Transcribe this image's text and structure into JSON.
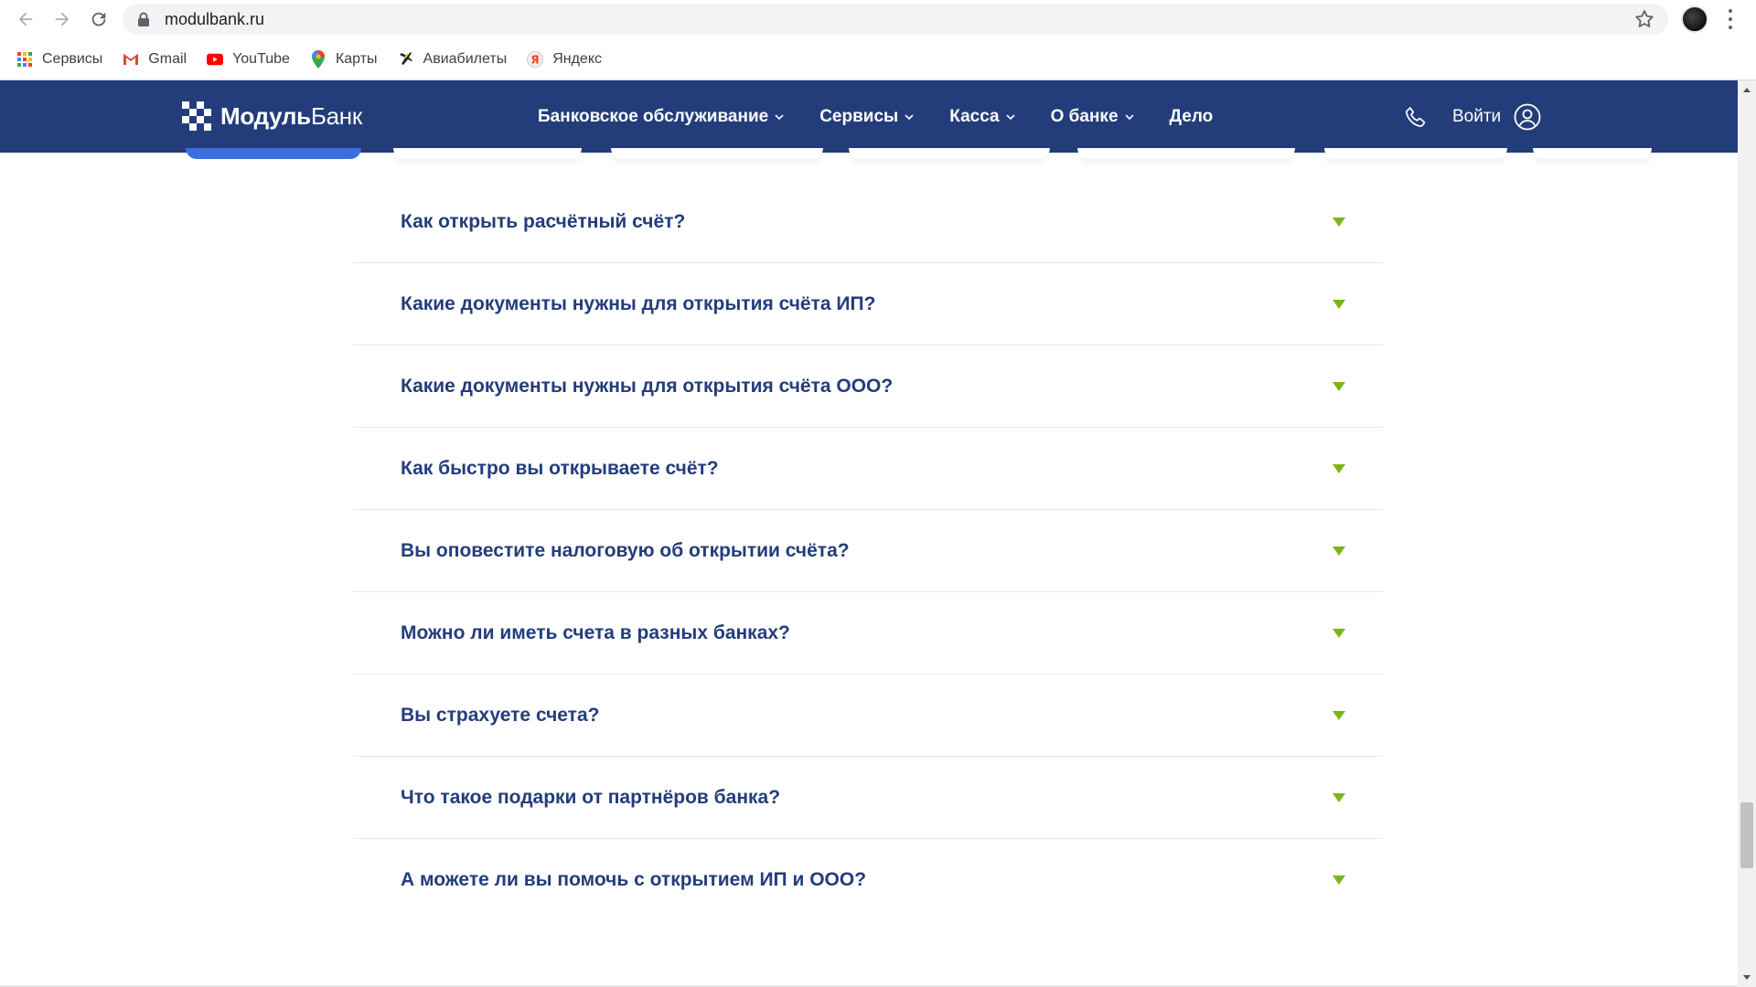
{
  "browser": {
    "url": "modulbank.ru",
    "bookmarks": [
      {
        "label": "Сервисы",
        "icon": "apps-grid-icon"
      },
      {
        "label": "Gmail",
        "icon": "gmail-icon"
      },
      {
        "label": "YouTube",
        "icon": "youtube-icon"
      },
      {
        "label": "Карты",
        "icon": "maps-pin-icon"
      },
      {
        "label": "Авиабилеты",
        "icon": "plane-icon"
      },
      {
        "label": "Яндекс",
        "icon": "yandex-icon"
      }
    ]
  },
  "header": {
    "logo_bold": "Модуль",
    "logo_light": "Банк",
    "nav": [
      {
        "label": "Банковское обслуживание",
        "has_dropdown": true
      },
      {
        "label": "Сервисы",
        "has_dropdown": true
      },
      {
        "label": "Касса",
        "has_dropdown": true
      },
      {
        "label": "О банке",
        "has_dropdown": true
      },
      {
        "label": "Дело",
        "has_dropdown": false
      }
    ],
    "login_label": "Войти"
  },
  "faq": {
    "items": [
      "Как открыть расчётный счёт?",
      "Какие документы нужны для открытия счёта ИП?",
      "Какие документы нужны для открытия счёта ООО?",
      "Как быстро вы открываете счёт?",
      "Вы оповестите налоговую об открытии счёта?",
      "Можно ли иметь счета в разных банках?",
      "Вы страхуете счета?",
      "Что такое подарки от партнёров банка?",
      "А можете ли вы помочь с открытием ИП и ООО?"
    ]
  },
  "colors": {
    "header_bg": "#233d7b",
    "faq_text": "#233d7b",
    "arrow_green": "#7cb518",
    "active_tab": "#3b6fe0"
  }
}
